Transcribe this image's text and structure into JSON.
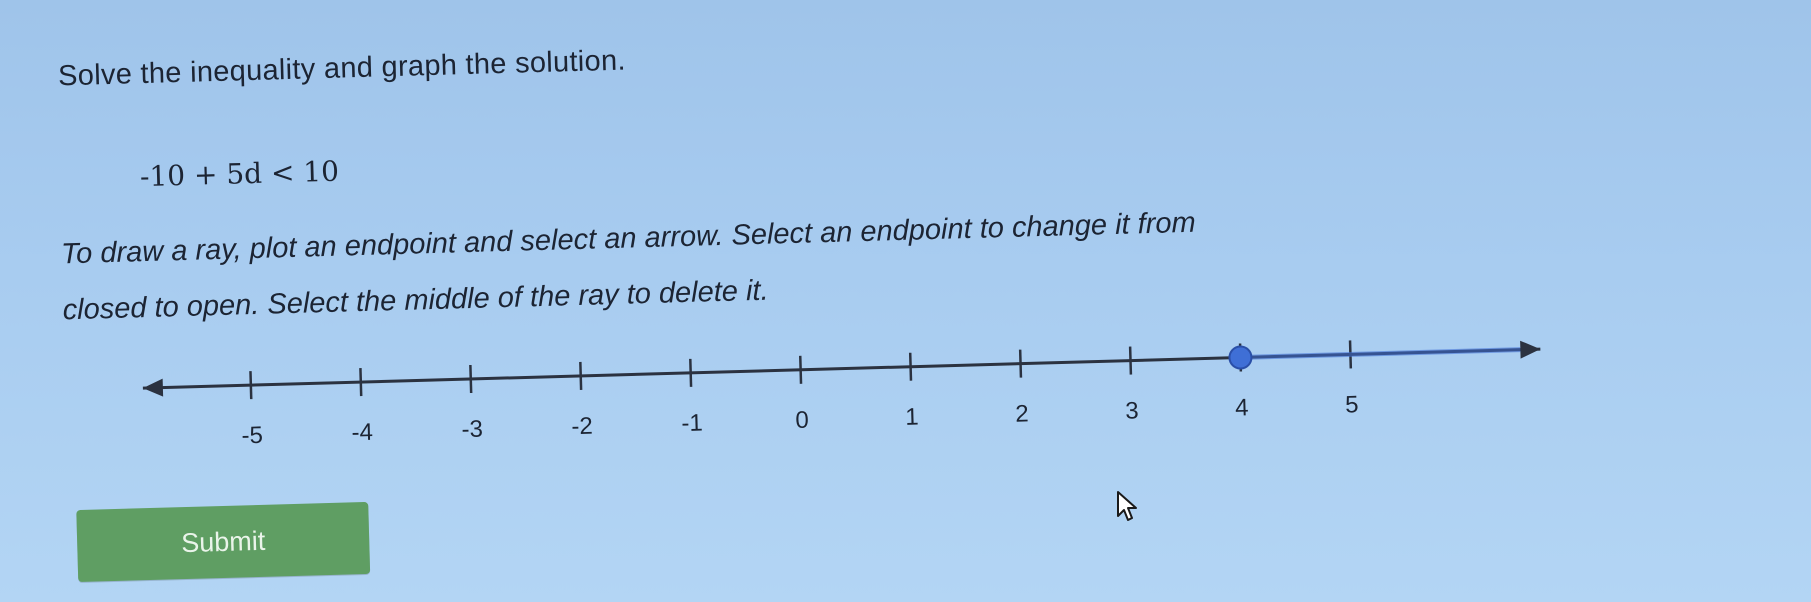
{
  "question": {
    "prompt": "Solve the inequality and graph the solution.",
    "equation": "-10 + 5d < 10",
    "instructions_line1": "To draw a ray, plot an endpoint and select an arrow. Select an endpoint to change it from",
    "instructions_line2": "closed to open. Select the middle of the ray to delete it."
  },
  "number_line": {
    "ticks": [
      -5,
      -4,
      -3,
      -2,
      -1,
      0,
      1,
      2,
      3,
      4,
      5
    ],
    "tick_labels": [
      "-5",
      "-4",
      "-3",
      "-2",
      "-1",
      "0",
      "1",
      "2",
      "3",
      "4",
      "5"
    ],
    "plotted_point": 4,
    "point_color": "#3f6fd6",
    "ray": {
      "from": 4,
      "to": "+infinity"
    }
  },
  "submit": {
    "label": "Submit"
  },
  "icons": {
    "cursor": "arrow-cursor-icon"
  },
  "colors": {
    "background": "#a8ccf0",
    "submit_button": "#5f9e63",
    "text": "#1c2433"
  }
}
